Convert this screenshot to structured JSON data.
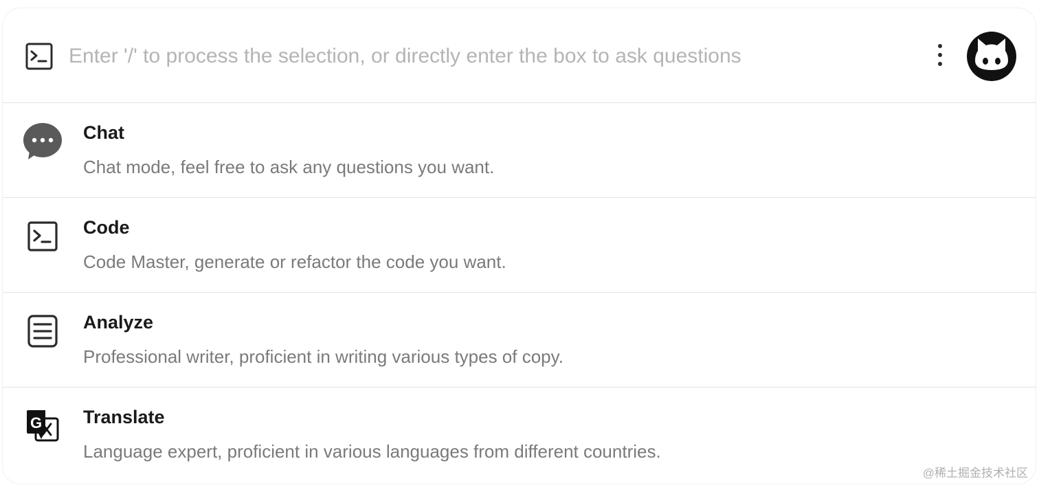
{
  "search": {
    "placeholder": "Enter '/' to process the selection, or directly enter the box to ask questions",
    "value": "",
    "leading_icon": "terminal-icon"
  },
  "header": {
    "menu_icon": "more-vertical-icon",
    "avatar_icon": "github-octocat-icon"
  },
  "modes": [
    {
      "icon": "chat-bubble-icon",
      "title": "Chat",
      "description": "Chat mode, feel free to ask any questions you want."
    },
    {
      "icon": "terminal-icon",
      "title": "Code",
      "description": "Code Master, generate or refactor the code you want."
    },
    {
      "icon": "document-icon",
      "title": "Analyze",
      "description": "Professional writer, proficient in writing various types of copy."
    },
    {
      "icon": "translate-icon",
      "title": "Translate",
      "description": "Language expert, proficient in various languages from different countries."
    }
  ],
  "watermark": "@稀土掘金技术社区",
  "colors": {
    "background": "#ffffff",
    "title": "#1a1a1a",
    "description": "#7a7a7a",
    "placeholder": "#b4b4b4",
    "divider": "#e3e3e3",
    "chat_icon": "#5a5a5a"
  }
}
